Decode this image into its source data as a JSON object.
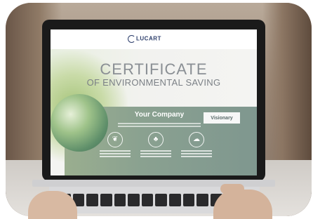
{
  "certificate": {
    "logo_text": "LUCART",
    "title_line1": "CERTIFICATE",
    "title_line2": "OF ENVIRONMENTAL SAVING",
    "company_name": "Your Company",
    "partner_logo": "Visionary"
  },
  "colors": {
    "band_green": "#8aa190",
    "title_gray": "#8a8f94",
    "brand_navy": "#2c3e6b"
  },
  "icons": [
    "leaf-icon",
    "tree-icon",
    "cloud-icon"
  ]
}
